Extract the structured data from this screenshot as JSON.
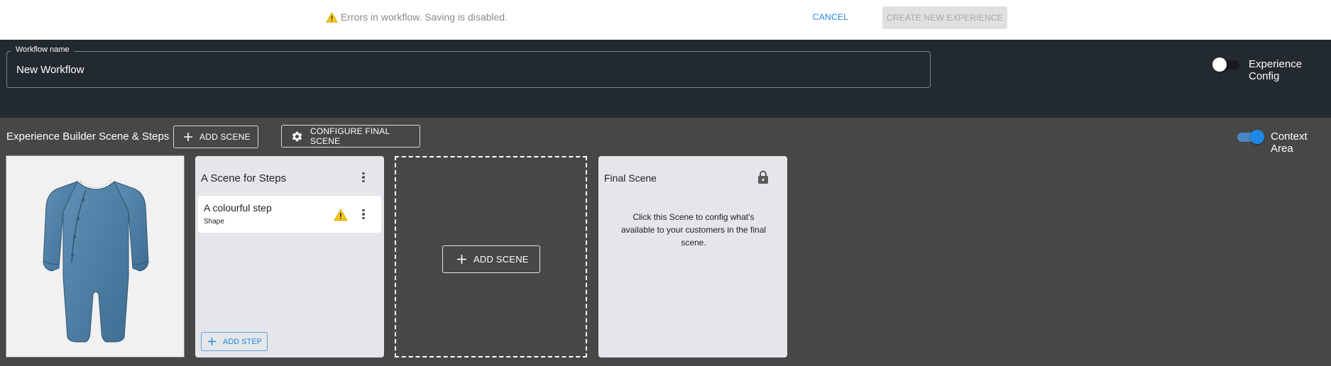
{
  "topbar": {
    "warning_text": "Errors in workflow. Saving is disabled.",
    "cancel_label": "CANCEL",
    "create_label": "CREATE NEW EXPERIENCE"
  },
  "header": {
    "workflow_name_label": "Workflow name",
    "workflow_name_value": "New Workflow",
    "experience_config_label": "Experience Config",
    "experience_config_on": false
  },
  "builder": {
    "title": "Experience Builder Scene & Steps",
    "add_scene_label": "ADD SCENE",
    "configure_final_label": "CONFIGURE FINAL SCENE",
    "context_area_label": "Context Area",
    "context_area_on": true
  },
  "scenes": [
    {
      "title": "A Scene for Steps",
      "steps": [
        {
          "title": "A colourful step",
          "type": "Shape",
          "status_icon": "warning-icon"
        }
      ],
      "add_step_label": "ADD STEP"
    }
  ],
  "new_scene": {
    "label": "ADD SCENE"
  },
  "final_scene": {
    "title": "Final Scene",
    "icon": "lock-icon",
    "description": "Click this Scene to config what's available to your customers in the final scene."
  },
  "product": {
    "image": "blue-baby-romper"
  },
  "colors": {
    "accent": "#1e88e5",
    "warning": "#f5c518",
    "header_bg": "#232a2f",
    "builder_bg": "#474747",
    "card_bg": "#e5e6ea"
  }
}
